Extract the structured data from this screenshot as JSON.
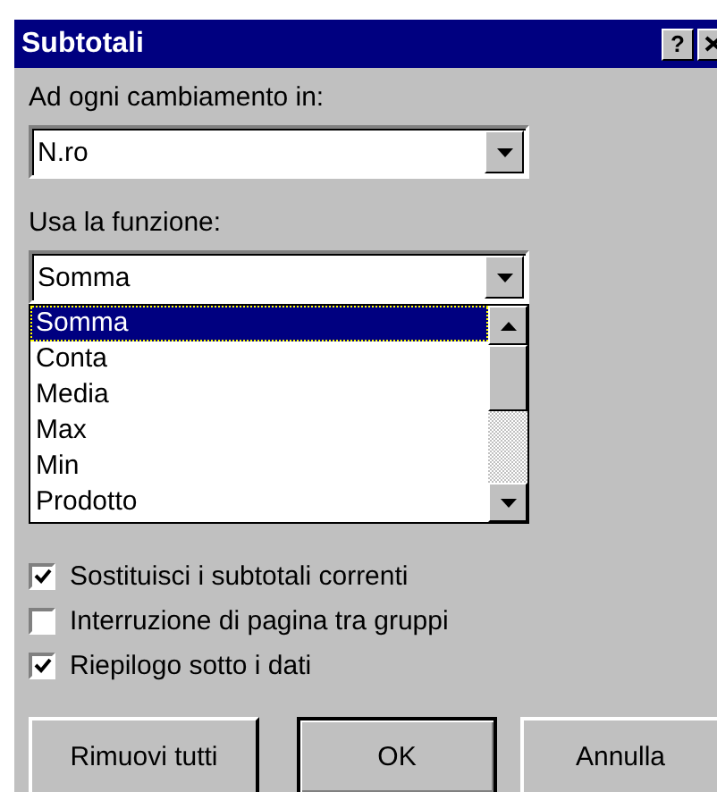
{
  "window": {
    "title": "Subtotali",
    "title_buttons": [
      "?"
    ]
  },
  "group_by": {
    "label": "Ad ogni cambiamento in:",
    "value": "N.ro"
  },
  "function": {
    "label": "Usa la funzione:",
    "value": "Somma",
    "options": [
      {
        "label": "Somma",
        "selected": true
      },
      {
        "label": "Conta",
        "selected": false
      },
      {
        "label": "Media",
        "selected": false
      },
      {
        "label": "Max",
        "selected": false
      },
      {
        "label": "Min",
        "selected": false
      },
      {
        "label": "Prodotto",
        "selected": false
      }
    ]
  },
  "options": [
    {
      "label": "Sostituisci i subtotali correnti",
      "checked": true
    },
    {
      "label": "Interruzione di pagina tra gruppi",
      "checked": false
    },
    {
      "label": "Riepilogo sotto i dati",
      "checked": true
    }
  ],
  "buttons": [
    {
      "label": "Rimuovi tutti",
      "default": false
    },
    {
      "label": "OK",
      "default": true
    },
    {
      "label": "Annulla",
      "default": false
    }
  ]
}
